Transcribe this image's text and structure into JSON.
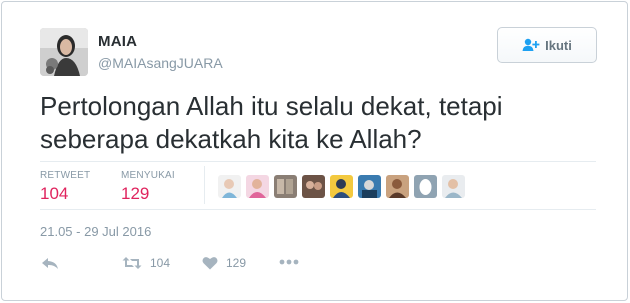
{
  "user": {
    "display_name": "MAIA",
    "screen_name": "@MAIAsangJUARA"
  },
  "follow_button": {
    "label": "Ikuti",
    "icon": "follow-user-icon"
  },
  "tweet": {
    "text": "Pertolongan Allah itu selalu dekat, tetapi seberapa dekatkah kita ke Allah?"
  },
  "stats": {
    "retweet_label": "RETWEET",
    "retweet_count": "104",
    "like_label": "MENYUKAI",
    "like_count": "129"
  },
  "likers_count_shown": 9,
  "timestamp": "21.05 - 29 Jul 2016",
  "actions": {
    "reply_icon": "reply-icon",
    "retweet_icon": "retweet-icon",
    "retweet_count": "104",
    "like_icon": "heart-icon",
    "like_count": "129",
    "more_icon": "more-dots-icon"
  },
  "colors": {
    "count_red": "#e0245e",
    "muted": "#8899a6",
    "text": "#292f33",
    "divider": "#e6ecf0"
  }
}
